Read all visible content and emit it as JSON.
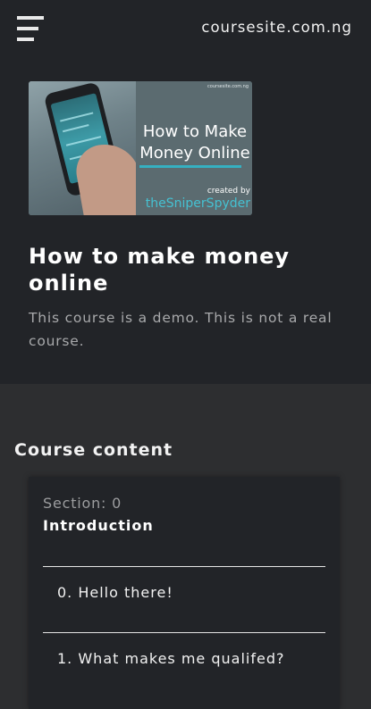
{
  "header": {
    "brand": "coursesite.com.ng",
    "menu_icon": "hamburger-menu-icon"
  },
  "thumbnail": {
    "site": "coursesite.com.ng",
    "line1": "How to Make",
    "line2": "Money Online",
    "created_by": "created by",
    "author": "theSniperSpyder"
  },
  "course": {
    "title": "How to make money online",
    "description": "This course is a demo. This is not a real course."
  },
  "content": {
    "heading": "Course content",
    "section_label": "Section: 0",
    "section_name": "Introduction",
    "lessons": [
      {
        "label": "0. Hello there!"
      },
      {
        "label": "1. What makes me qualifed?"
      }
    ]
  }
}
